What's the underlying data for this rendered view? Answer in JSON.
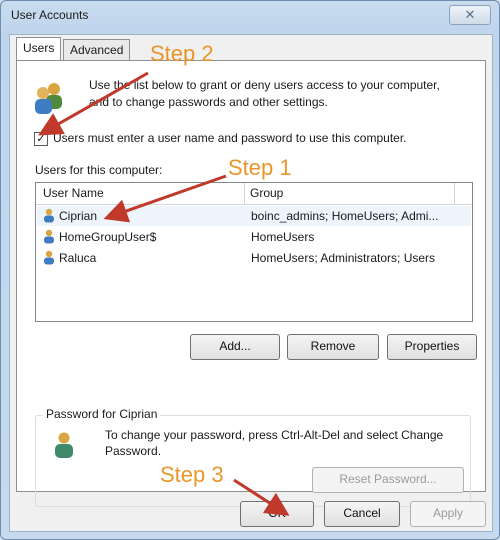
{
  "window": {
    "title": "User Accounts",
    "close_glyph": "✕"
  },
  "tabs": [
    {
      "label": "Users"
    },
    {
      "label": "Advanced"
    }
  ],
  "intro_text": "Use the list below to grant or deny users access to your computer, and to change passwords and other settings.",
  "checkbox": {
    "label": "Users must enter a user name and password to use this computer.",
    "checked": true,
    "mark": "✓"
  },
  "users_label": "Users for this computer:",
  "table": {
    "headers": [
      "User Name",
      "Group"
    ],
    "rows": [
      {
        "name": "Ciprian",
        "group": "boinc_admins; HomeUsers; Admi...",
        "selected": true
      },
      {
        "name": "HomeGroupUser$",
        "group": "HomeUsers",
        "selected": false
      },
      {
        "name": "Raluca",
        "group": "HomeUsers; Administrators; Users",
        "selected": false
      }
    ]
  },
  "buttons": {
    "add": "Add...",
    "remove": "Remove",
    "properties": "Properties",
    "reset_password": "Reset Password...",
    "ok": "OK",
    "cancel": "Cancel",
    "apply": "Apply"
  },
  "password_group": {
    "title": "Password for Ciprian",
    "text": "To change your password, press Ctrl-Alt-Del and select Change Password."
  },
  "annotations": {
    "step1": "Step 1",
    "step2": "Step 2",
    "step3": "Step 3",
    "color": "#e8962b",
    "arrow_color": "#c0392b"
  },
  "icons": [
    "users-icon",
    "user-icon",
    "password-user-icon",
    "close-icon",
    "checkmark-icon",
    "arrow"
  ]
}
